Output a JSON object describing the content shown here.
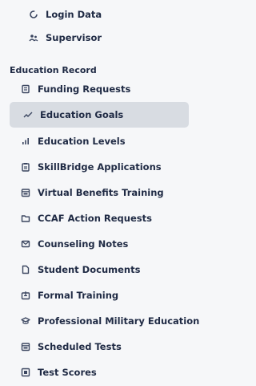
{
  "top_items": [
    {
      "label": "Login Data",
      "icon": "circle-icon"
    },
    {
      "label": "Supervisor",
      "icon": "people-icon"
    }
  ],
  "section_title": "Education Record",
  "items": [
    {
      "label": "Funding Requests",
      "icon": "receipt-icon"
    },
    {
      "label": "Education Goals",
      "icon": "trend-line-icon",
      "active": true
    },
    {
      "label": "Education Levels",
      "icon": "bar-chart-icon"
    },
    {
      "label": "SkillBridge Applications",
      "icon": "clipboard-icon"
    },
    {
      "label": "Virtual Benefits Training",
      "icon": "calendar-icon"
    },
    {
      "label": "CCAF Action Requests",
      "icon": "folder-icon"
    },
    {
      "label": "Counseling Notes",
      "icon": "envelope-icon"
    },
    {
      "label": "Student Documents",
      "icon": "document-icon"
    },
    {
      "label": "Formal Training",
      "icon": "box-icon"
    },
    {
      "label": "Professional Military Education",
      "icon": "graduation-cap-icon"
    },
    {
      "label": "Scheduled Tests",
      "icon": "calendar-icon"
    },
    {
      "label": "Test Scores",
      "icon": "scorecard-icon"
    }
  ],
  "colors": {
    "active_bg": "#d8dce2",
    "text": "#1f2a44",
    "sidebar_bg": "#f6f7f9"
  }
}
